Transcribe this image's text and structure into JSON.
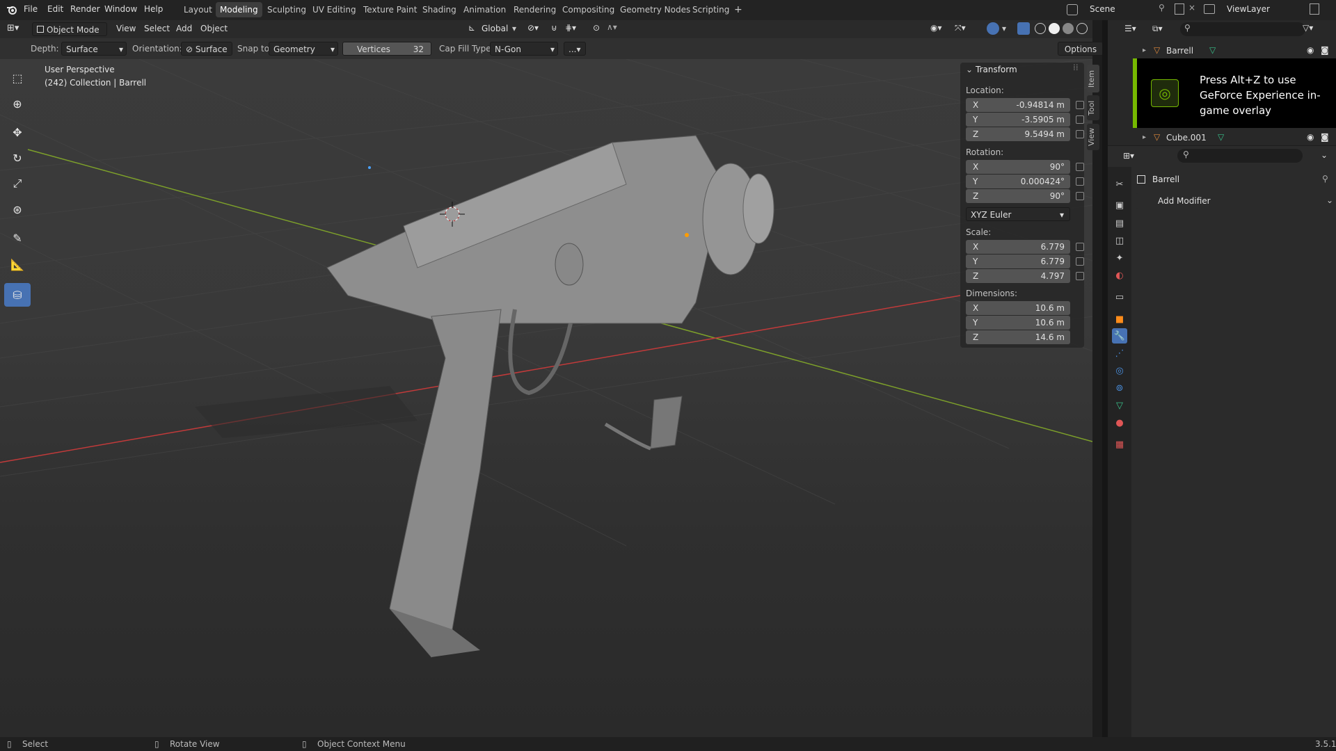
{
  "menu": {
    "items": [
      "File",
      "Edit",
      "Render",
      "Window",
      "Help"
    ],
    "workspaces": [
      "Layout",
      "Modeling",
      "Sculpting",
      "UV Editing",
      "Texture Paint",
      "Shading",
      "Animation",
      "Rendering",
      "Compositing",
      "Geometry Nodes",
      "Scripting"
    ],
    "active_workspace": "Modeling",
    "add_tab": "+",
    "scene": "Scene",
    "view_layer": "ViewLayer"
  },
  "viewport_header": {
    "mode": "Object Mode",
    "menus": [
      "View",
      "Select",
      "Add",
      "Object"
    ],
    "transform_orientation": "Global"
  },
  "tool_header": {
    "depth_label": "Depth:",
    "depth_value": "Surface",
    "orientation_label": "Orientation:",
    "orientation_value": "Surface",
    "snap_label": "Snap to:",
    "snap_value": "Geometry",
    "vertices_label": "Vertices",
    "vertices_value": "32",
    "cap_fill_label": "Cap Fill Type:",
    "cap_fill_value": "N-Gon",
    "more": "...",
    "options": "Options"
  },
  "overlay": {
    "perspective": "User Perspective",
    "collection": "(242) Collection | Barrell"
  },
  "transform": {
    "title": "Transform",
    "location_label": "Location:",
    "location": [
      {
        "axis": "X",
        "value": "-0.94814 m"
      },
      {
        "axis": "Y",
        "value": "-3.5905 m"
      },
      {
        "axis": "Z",
        "value": "9.5494 m"
      }
    ],
    "rotation_label": "Rotation:",
    "rotation": [
      {
        "axis": "X",
        "value": "90°"
      },
      {
        "axis": "Y",
        "value": "0.000424°"
      },
      {
        "axis": "Z",
        "value": "90°"
      }
    ],
    "rotation_mode": "XYZ Euler",
    "scale_label": "Scale:",
    "scale": [
      {
        "axis": "X",
        "value": "6.779"
      },
      {
        "axis": "Y",
        "value": "6.779"
      },
      {
        "axis": "Z",
        "value": "4.797"
      }
    ],
    "dimensions_label": "Dimensions:",
    "dimensions": [
      {
        "axis": "X",
        "value": "10.6 m"
      },
      {
        "axis": "Y",
        "value": "10.6 m"
      },
      {
        "axis": "Z",
        "value": "14.6 m"
      }
    ]
  },
  "side_tabs": [
    "Item",
    "Tool",
    "View"
  ],
  "outliner": {
    "items": [
      "Barrell",
      "Cube.001"
    ]
  },
  "nvidia_overlay": "Press Alt+Z to use GeForce Experience in-game overlay",
  "properties": {
    "object_name": "Barrell",
    "add_modifier": "Add Modifier"
  },
  "statusbar": {
    "select": "Select",
    "rotate": "Rotate View",
    "context": "Object Context Menu",
    "version": "3.5.1"
  },
  "colors": {
    "accent": "#4772b3",
    "nvidia_green": "#76b900",
    "x_axis": "#c23a3a",
    "y_axis": "#7da02a"
  }
}
